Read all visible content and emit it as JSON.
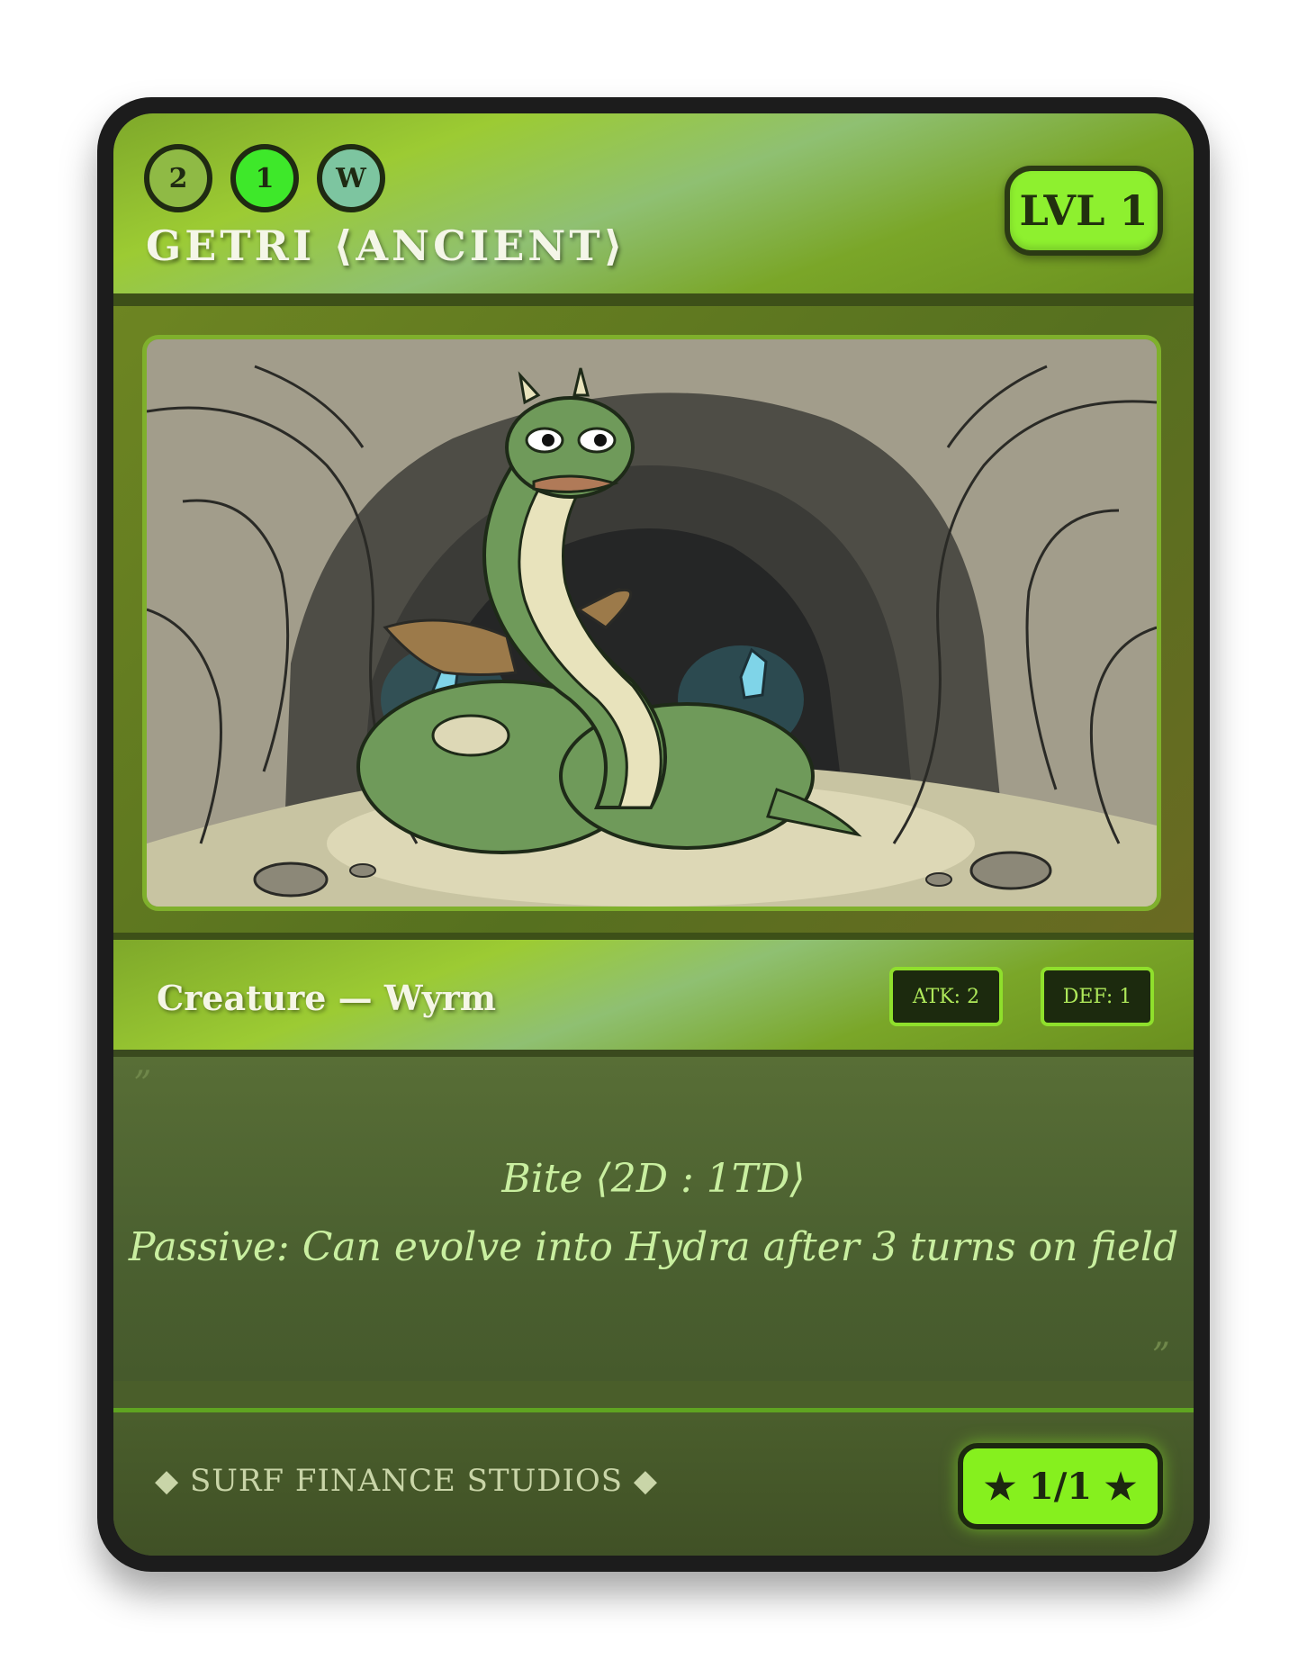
{
  "card": {
    "cost": [
      "2",
      "1",
      "W"
    ],
    "name": "GETRI ⟨ANCIENT⟩",
    "level": "LVL 1",
    "type_line": "Creature — Wyrm",
    "atk": "ATK: 2",
    "def": "DEF: 1",
    "quote_open": "”",
    "quote_close": "”",
    "ability_1": "Bite ⟨2D : 1TD⟩",
    "ability_2": "Passive: Can evolve into Hydra after 3 turns on field",
    "studio": "◆ SURF FINANCE STUDIOS ◆",
    "edition": "★ 1/1 ★"
  },
  "colors": {
    "frame": "#1c1c1c",
    "accent_green": "#8ef02f",
    "header_green": "#9ccb33",
    "text_light_green": "#c9efa0"
  }
}
